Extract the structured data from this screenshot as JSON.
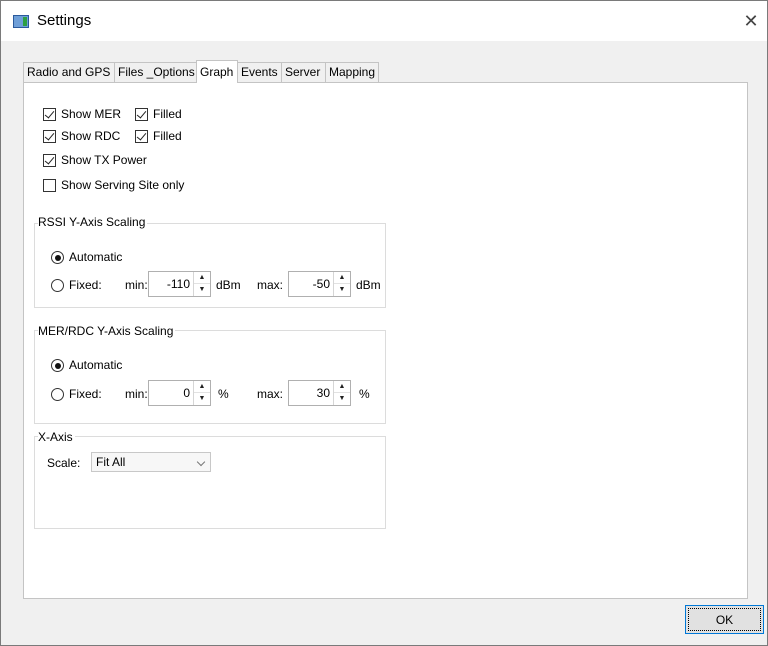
{
  "window": {
    "title": "Settings"
  },
  "tabs": [
    {
      "label": "Radio and GPS",
      "active": false
    },
    {
      "label": "Files _Options",
      "active": false
    },
    {
      "label": "Graph",
      "active": true
    },
    {
      "label": "Events",
      "active": false
    },
    {
      "label": "Server",
      "active": false
    },
    {
      "label": "Mapping",
      "active": false
    }
  ],
  "graph": {
    "checkboxes": {
      "show_mer": {
        "label": "Show MER",
        "checked": true
      },
      "mer_filled": {
        "label": "Filled",
        "checked": true
      },
      "show_rdc": {
        "label": "Show RDC",
        "checked": true
      },
      "rdc_filled": {
        "label": "Filled",
        "checked": true
      },
      "show_tx_power": {
        "label": "Show TX Power",
        "checked": true
      },
      "show_serving_site": {
        "label": "Show Serving Site only",
        "checked": false
      }
    },
    "rssi": {
      "title": "RSSI Y-Axis Scaling",
      "automatic_label": "Automatic",
      "fixed_label": "Fixed:",
      "min_label": "min:",
      "min_value": "-110",
      "min_unit": "dBm",
      "max_label": "max:",
      "max_value": "-50",
      "max_unit": "dBm",
      "mode": "Automatic"
    },
    "mer_rdc": {
      "title": "MER/RDC Y-Axis Scaling",
      "automatic_label": "Automatic",
      "fixed_label": "Fixed:",
      "min_label": "min:",
      "min_value": "0",
      "min_unit": "%",
      "max_label": "max:",
      "max_value": "30",
      "max_unit": "%",
      "mode": "Automatic"
    },
    "xaxis": {
      "title": "X-Axis",
      "scale_label": "Scale:",
      "scale_value": "Fit All"
    }
  },
  "footer": {
    "ok_label": "OK"
  }
}
